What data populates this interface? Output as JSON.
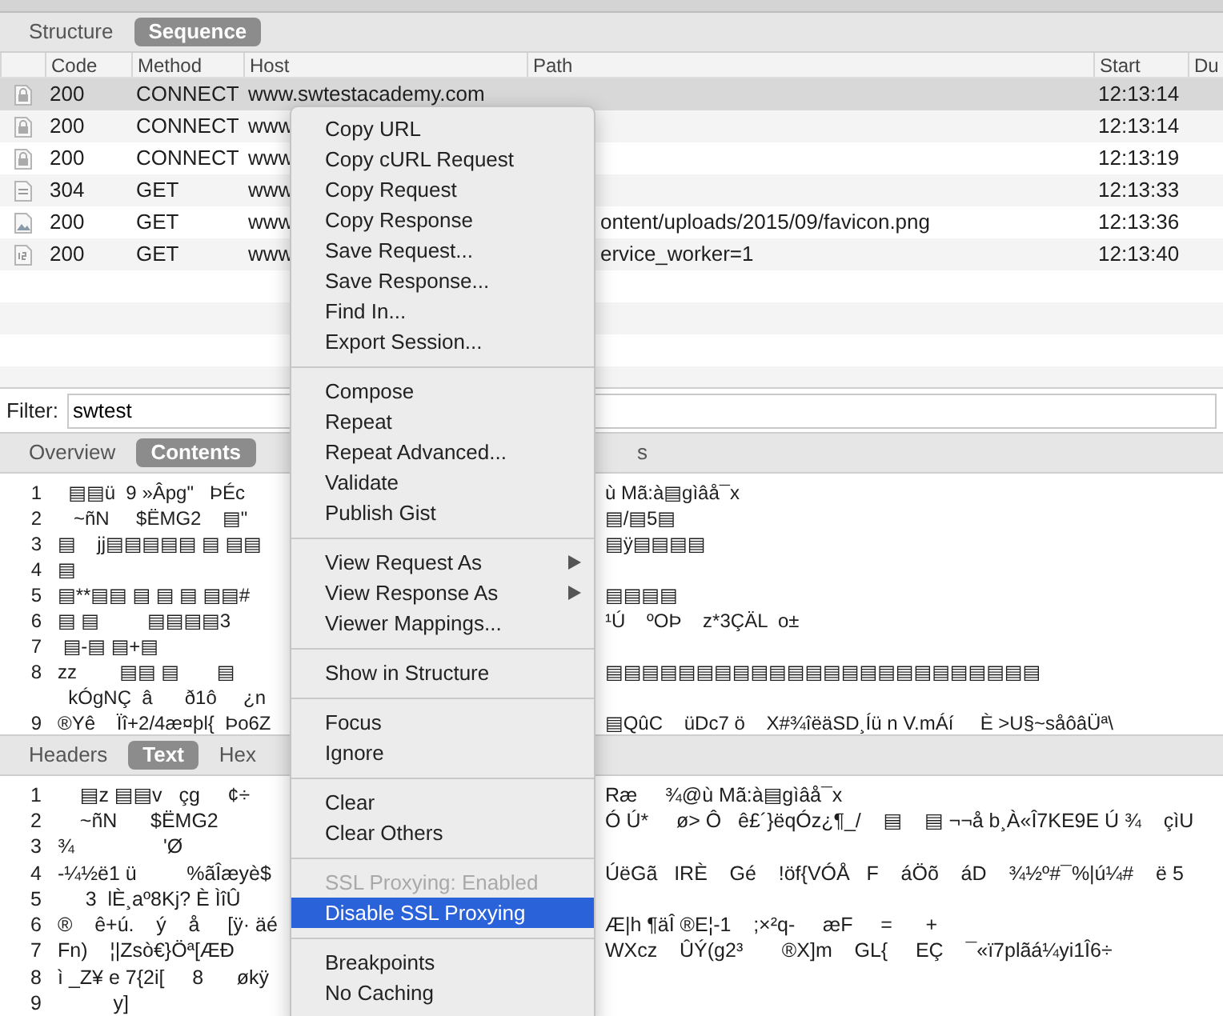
{
  "top_tabs": [
    {
      "label": "Structure",
      "selected": false
    },
    {
      "label": "Sequence",
      "selected": true
    }
  ],
  "table": {
    "columns": [
      "Code",
      "Method",
      "Host",
      "Path",
      "Start",
      "Du"
    ],
    "rows": [
      {
        "kind": "lock",
        "code": "200",
        "method": "CONNECT",
        "host": "www.swtestacademy.com",
        "start": "12:13:14",
        "selected": true
      },
      {
        "kind": "lock",
        "code": "200",
        "method": "CONNECT",
        "host": "www",
        "start": "12:13:14",
        "selected": false
      },
      {
        "kind": "lock",
        "code": "200",
        "method": "CONNECT",
        "host": "www",
        "start": "12:13:19",
        "selected": false
      },
      {
        "kind": "equals",
        "code": "304",
        "method": "GET",
        "host": "www",
        "start": "12:13:33",
        "selected": false
      },
      {
        "kind": "image",
        "code": "200",
        "method": "GET",
        "host": "www",
        "path": "ontent/uploads/2015/09/favicon.png",
        "start": "12:13:36",
        "selected": false
      },
      {
        "kind": "script",
        "code": "200",
        "method": "GET",
        "host": "www",
        "path": "ervice_worker=1",
        "start": "12:13:40",
        "selected": false
      }
    ]
  },
  "filter": {
    "label": "Filter:",
    "value": "swtest"
  },
  "content_tabs": [
    {
      "label": "Overview",
      "selected": false
    },
    {
      "label": "Contents",
      "selected": true
    },
    {
      "label": "s",
      "selected": false
    }
  ],
  "contents_lines": [
    {
      "number": "1",
      "left": "  ▤▤ü  9 »Âpg\"   ÞÉc",
      "right": "ù Mã:à▤gìâå¯x"
    },
    {
      "number": "2",
      "left": "   ~ñN     $ËMG2    ▤\"",
      "right": "▤/▤5▤"
    },
    {
      "number": "3",
      "left": "▤    jj▤▤▤▤▤ ▤ ▤▤",
      "right": "▤ÿ▤▤▤▤"
    },
    {
      "number": "4",
      "left": "▤"
    },
    {
      "number": "5",
      "left": "▤**▤▤ ▤ ▤ ▤ ▤▤#",
      "right": "▤▤▤▤"
    },
    {
      "number": "6",
      "left": "▤ ▤         ▤▤▤▤3",
      "right": "¹Ú    ºOÞ    z*3ÇÄL  o±"
    },
    {
      "number": "7",
      "left": " ▤-▤ ▤+▤"
    },
    {
      "number": "8",
      "left": "zz        ▤▤ ▤       ▤",
      "right": "▤▤▤▤▤▤▤▤▤▤▤▤▤▤▤▤▤▤▤▤▤▤▤▤"
    },
    {
      "left": "  kÓgNÇ  â      ð1ô     ¿n"
    },
    {
      "number": "9",
      "left": "®Yê    Ïî+2/4æ¤þl{  Þo6Z",
      "right": "▤QûC    üDc7 ö    X#¾îëäSD¸Íü n V.mÁí     È >U§~såôâÜª\\"
    }
  ],
  "body_tabs": [
    {
      "label": "Headers",
      "selected": false
    },
    {
      "label": "Text",
      "selected": true
    },
    {
      "label": "Hex",
      "selected": false
    }
  ],
  "text_lines": [
    {
      "number": "1",
      "left": "    ▤z ▤▤v   çg     ¢÷",
      "right": "Ræ     ¾@ù Mã:à▤gìâå¯x"
    },
    {
      "number": "2",
      "left": "    ~ñN      $ËMG2",
      "right": "Ó Ú*     ø> Ô   ê£´}ëqÓz¿¶_/    ▤    ▤ ¬¬å b¸À«Î7KE9E Ú ¾    çìU"
    },
    {
      "number": "3",
      "left": "¾                'Ø"
    },
    {
      "number": "4",
      "left": "-¼½ë1 ü         %ãÎæyè$",
      "right": "ÚëGã   IRÈ    Gé    !öf{VÓÅ   F    áÖõ    áD    ¾½º#¯%|ú¼#    ë 5"
    },
    {
      "number": "5",
      "left": "     3  lÈ¸aº8Kj? È ÌîÛ"
    },
    {
      "number": "6",
      "left": "®    ê+ú.    ý    å     [ÿ· äé",
      "right": "Æ|h ¶äÎ ®E¦-1    ;×²q-     æF     =      +"
    },
    {
      "number": "7",
      "left": "Fn)    ¦|Zsò€}Öª[ÆÐ",
      "right": "WXcz    ÛÝ(g2³       ®X]m    GL{     EÇ    ¯«ï7plãá¼yi1Î6÷"
    },
    {
      "number": "8",
      "left": "ì _Z¥ e 7{2i[     8      økÿ"
    },
    {
      "number": "9",
      "left": "          y]"
    }
  ],
  "context_menu": {
    "sections": [
      [
        {
          "label": "Copy URL",
          "submenu": false,
          "disabled": false,
          "selected": false
        },
        {
          "label": "Copy cURL Request",
          "submenu": false,
          "disabled": false,
          "selected": false
        },
        {
          "label": "Copy Request",
          "submenu": false,
          "disabled": false,
          "selected": false
        },
        {
          "label": "Copy Response",
          "submenu": false,
          "disabled": false,
          "selected": false
        },
        {
          "label": "Save Request...",
          "submenu": false,
          "disabled": false,
          "selected": false
        },
        {
          "label": "Save Response...",
          "submenu": false,
          "disabled": false,
          "selected": false
        },
        {
          "label": "Find In...",
          "submenu": false,
          "disabled": false,
          "selected": false
        },
        {
          "label": "Export Session...",
          "submenu": false,
          "disabled": false,
          "selected": false
        }
      ],
      [
        {
          "label": "Compose",
          "submenu": false,
          "disabled": false,
          "selected": false
        },
        {
          "label": "Repeat",
          "submenu": false,
          "disabled": false,
          "selected": false
        },
        {
          "label": "Repeat Advanced...",
          "submenu": false,
          "disabled": false,
          "selected": false
        },
        {
          "label": "Validate",
          "submenu": false,
          "disabled": false,
          "selected": false
        },
        {
          "label": "Publish Gist",
          "submenu": false,
          "disabled": false,
          "selected": false
        }
      ],
      [
        {
          "label": "View Request As",
          "submenu": true,
          "disabled": false,
          "selected": false
        },
        {
          "label": "View Response As",
          "submenu": true,
          "disabled": false,
          "selected": false
        },
        {
          "label": "Viewer Mappings...",
          "submenu": false,
          "disabled": false,
          "selected": false
        }
      ],
      [
        {
          "label": "Show in Structure",
          "submenu": false,
          "disabled": false,
          "selected": false
        }
      ],
      [
        {
          "label": "Focus",
          "submenu": false,
          "disabled": false,
          "selected": false
        },
        {
          "label": "Ignore",
          "submenu": false,
          "disabled": false,
          "selected": false
        }
      ],
      [
        {
          "label": "Clear",
          "submenu": false,
          "disabled": false,
          "selected": false
        },
        {
          "label": "Clear Others",
          "submenu": false,
          "disabled": false,
          "selected": false
        }
      ],
      [
        {
          "label": "SSL Proxying: Enabled",
          "submenu": false,
          "disabled": true,
          "selected": false
        },
        {
          "label": "Disable SSL Proxying",
          "submenu": false,
          "disabled": false,
          "selected": true
        }
      ],
      [
        {
          "label": "Breakpoints",
          "submenu": false,
          "disabled": false,
          "selected": false
        },
        {
          "label": "No Caching",
          "submenu": false,
          "disabled": false,
          "selected": false
        }
      ]
    ]
  }
}
